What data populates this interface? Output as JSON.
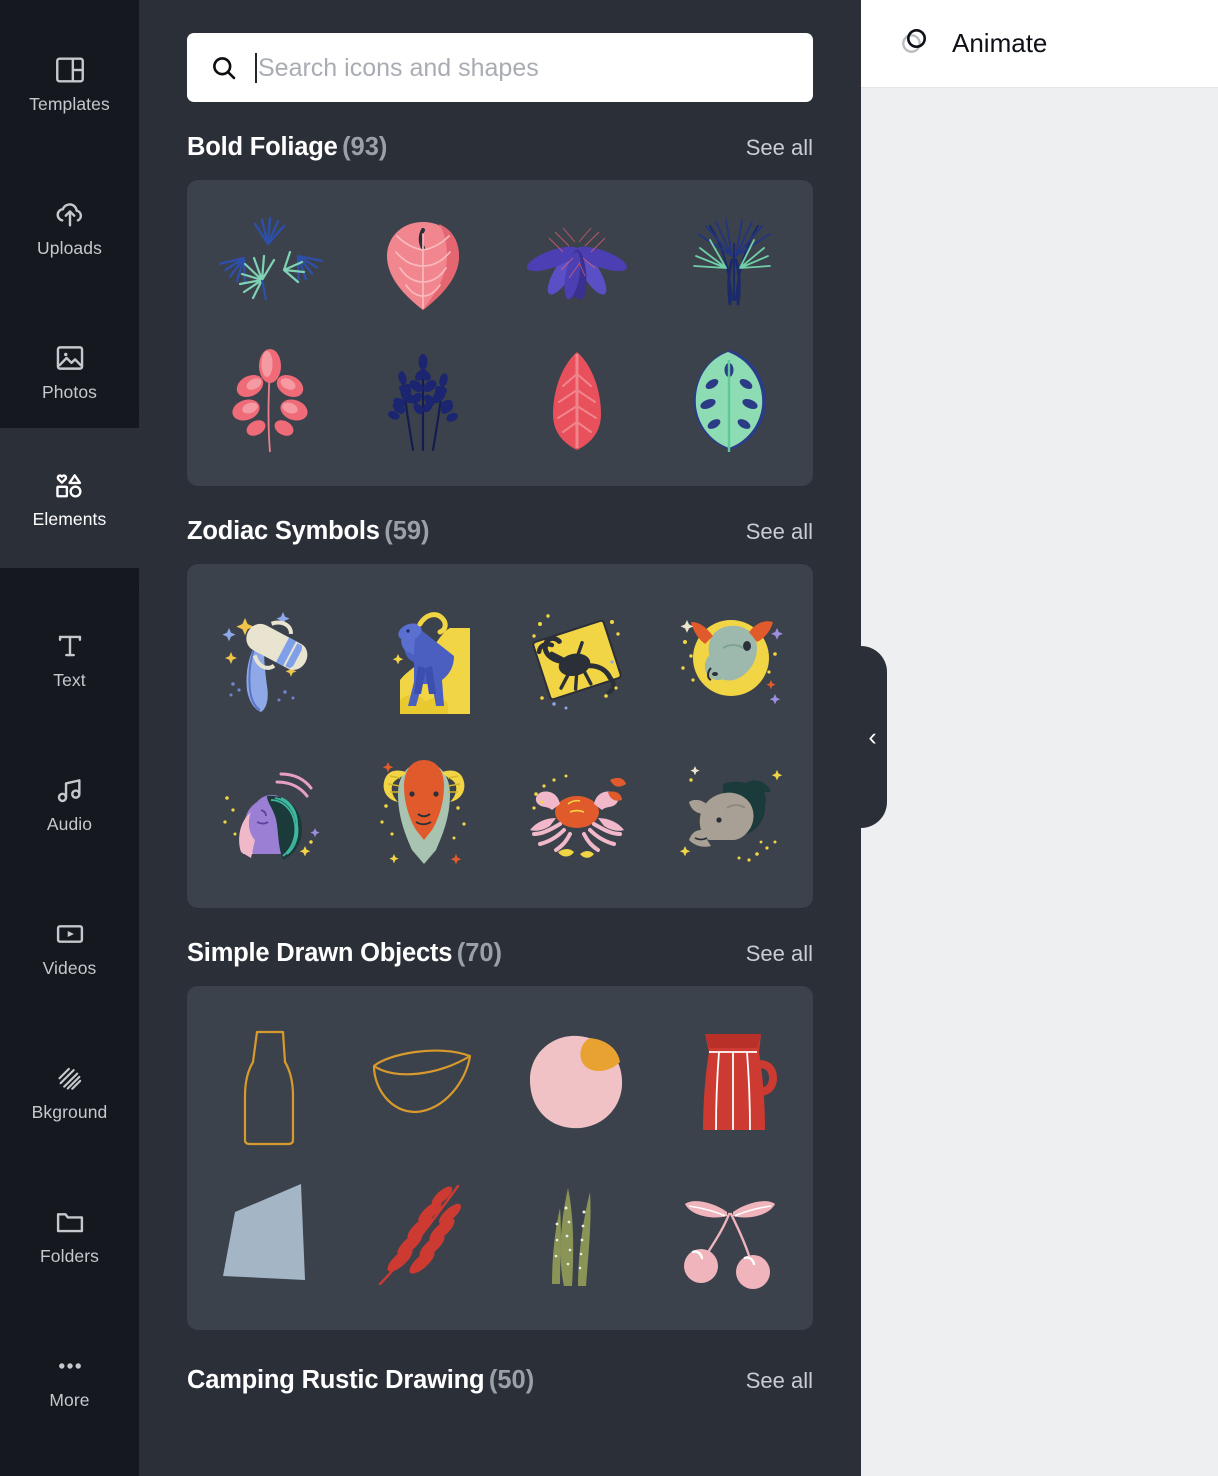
{
  "sidebar": {
    "items": [
      {
        "label": "Templates",
        "icon": "templates-icon",
        "active": false
      },
      {
        "label": "Uploads",
        "icon": "upload-cloud-icon",
        "active": false
      },
      {
        "label": "Photos",
        "icon": "image-icon",
        "active": false
      },
      {
        "label": "Elements",
        "icon": "shapes-icon",
        "active": true
      },
      {
        "label": "Text",
        "icon": "text-icon",
        "active": false
      },
      {
        "label": "Audio",
        "icon": "music-note-icon",
        "active": false
      },
      {
        "label": "Videos",
        "icon": "video-icon",
        "active": false
      },
      {
        "label": "Bkground",
        "icon": "hatch-pattern-icon",
        "active": false
      },
      {
        "label": "Folders",
        "icon": "folder-icon",
        "active": false
      },
      {
        "label": "More",
        "icon": "ellipsis-icon",
        "active": false
      }
    ]
  },
  "search": {
    "placeholder": "Search icons and shapes",
    "value": "",
    "icon": "search-icon"
  },
  "sections": [
    {
      "title": "Bold Foliage",
      "count": "(93)",
      "see_all": "See all",
      "items": [
        "blue-mint-fan-leaves",
        "pink-heart-leaf",
        "purple-palm-fronds",
        "blue-mint-grass-plant",
        "pink-branch-leaves",
        "navy-wheat-stalks",
        "red-feather-leaf",
        "mint-monstera-leaf"
      ]
    },
    {
      "title": "Zodiac Symbols",
      "count": "(59)",
      "see_all": "See all",
      "items": [
        "aquarius-water-jug",
        "capricorn-blue-goat",
        "scorpio-scorpion",
        "taurus-bull-head",
        "virgo-maiden",
        "aries-ram-head",
        "cancer-crab",
        "capricorn-goat-head"
      ]
    },
    {
      "title": "Simple Drawn Objects",
      "count": "(70)",
      "see_all": "See all",
      "items": [
        "bottle-outline",
        "bowl-outline",
        "peach-fruit",
        "red-pitcher",
        "blue-gray-abstract-shape",
        "red-fern-leaf",
        "aloe-plant",
        "pink-cherries"
      ]
    },
    {
      "title": "Camping Rustic Drawing",
      "count": "(50)",
      "see_all": "See all",
      "items": []
    }
  ],
  "collapse_handle": {
    "icon": "chevron-left-icon"
  },
  "toolbar": {
    "animate_label": "Animate",
    "animate_icon": "overlapping-circles-icon"
  },
  "colors": {
    "rail_bg": "#15191f",
    "panel_bg": "#2a2f38",
    "card_bg": "#3b424c",
    "canvas_bg": "#eeeff1",
    "toolbar_bg": "#ffffff",
    "text_primary": "#ffffff",
    "text_muted": "#9aa0a8"
  }
}
